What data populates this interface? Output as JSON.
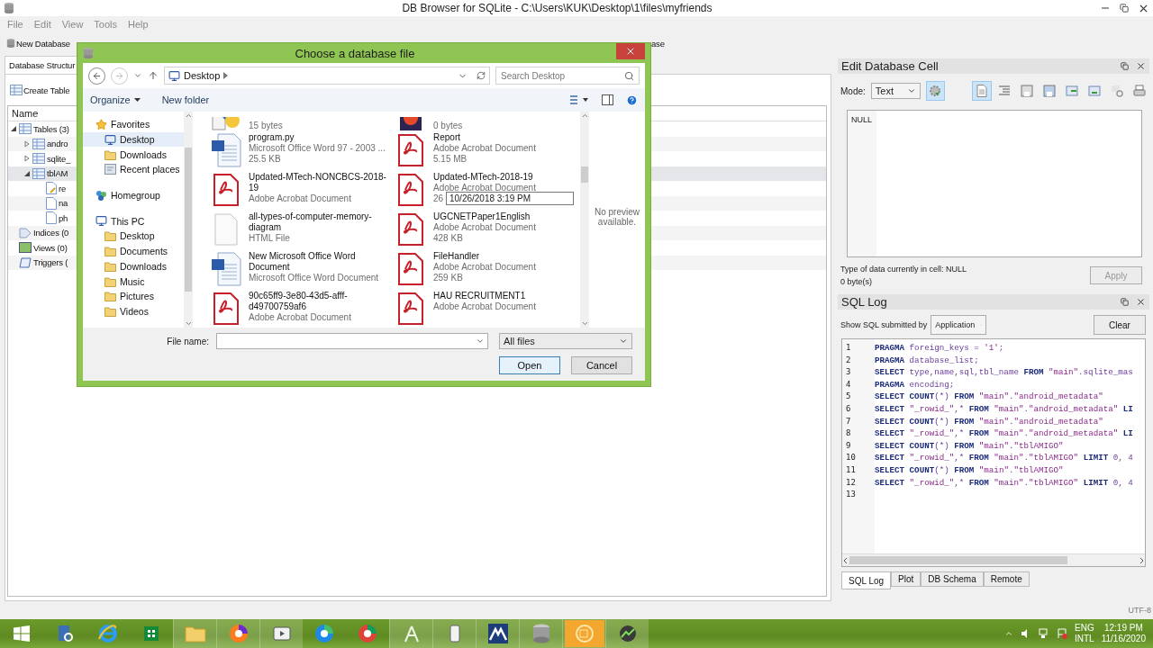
{
  "window": {
    "title": "DB Browser for SQLite - C:\\Users\\KUK\\Desktop\\1\\files\\myfriends"
  },
  "menu": [
    {
      "label": "File",
      "disabled": true
    },
    {
      "label": "Edit",
      "disabled": true
    },
    {
      "label": "View",
      "disabled": true
    },
    {
      "label": "Tools",
      "disabled": true
    },
    {
      "label": "Help",
      "disabled": true
    }
  ],
  "toolbar": [
    {
      "label": "New Database"
    },
    {
      "label": "ase"
    }
  ],
  "main_tabs": [
    {
      "label": "Database Structur",
      "selected": true
    }
  ],
  "structure": {
    "create_button": "Create Table",
    "column": "Name",
    "tree": [
      {
        "label": "Tables (3)",
        "kind": "group",
        "expanded": true,
        "selected": false,
        "children": [
          {
            "label": "andro",
            "kind": "table",
            "expanded": false,
            "selected": false
          },
          {
            "label": "sqlite_",
            "kind": "table",
            "expanded": false,
            "selected": false
          },
          {
            "label": "tblAM",
            "kind": "table",
            "expanded": true,
            "selected": true,
            "children": [
              {
                "label": "re",
                "kind": "key-field",
                "selected": false
              },
              {
                "label": "na",
                "kind": "field",
                "selected": false
              },
              {
                "label": "ph",
                "kind": "field",
                "selected": false
              }
            ]
          }
        ]
      },
      {
        "label": "Indices (0",
        "kind": "index",
        "selected": false
      },
      {
        "label": "Views (0)",
        "kind": "view",
        "selected": false
      },
      {
        "label": "Triggers (",
        "kind": "trigger",
        "selected": false
      }
    ]
  },
  "edit_cell": {
    "title": "Edit Database Cell",
    "mode_label": "Mode:",
    "mode": "Text",
    "auto_switch": {
      "pressed": true
    },
    "tools": [
      {
        "kind": "text",
        "pressed": true
      },
      {
        "kind": "indent",
        "pressed": false
      },
      {
        "kind": "save",
        "pressed": false
      },
      {
        "kind": "save-as",
        "pressed": false
      },
      {
        "kind": "export",
        "pressed": false
      },
      {
        "kind": "import",
        "pressed": false
      },
      {
        "kind": "null",
        "pressed": false
      },
      {
        "kind": "print",
        "pressed": false
      }
    ],
    "value": "NULL",
    "type_info": "Type of data currently in cell: NULL",
    "size_info": "0 byte(s)",
    "apply": {
      "label": "Apply",
      "disabled": true
    }
  },
  "sql_log": {
    "title": "SQL Log",
    "filter_label": "Show SQL submitted by",
    "filter": "Application",
    "clear": "Clear",
    "lines": [
      {
        "number": "1",
        "code": "PRAGMA foreign_keys = '1';"
      },
      {
        "number": "2",
        "code": "PRAGMA database_list;"
      },
      {
        "number": "3",
        "code": "SELECT type,name,sql,tbl_name FROM \"main\".sqlite_mas"
      },
      {
        "number": "4",
        "code": "PRAGMA encoding;"
      },
      {
        "number": "5",
        "code": "SELECT COUNT(*) FROM \"main\".\"android_metadata\""
      },
      {
        "number": "6",
        "code": "SELECT \"_rowid_\",* FROM \"main\".\"android_metadata\" LI"
      },
      {
        "number": "7",
        "code": "SELECT COUNT(*) FROM \"main\".\"android_metadata\""
      },
      {
        "number": "8",
        "code": "SELECT \"_rowid_\",* FROM \"main\".\"android_metadata\" LI"
      },
      {
        "number": "9",
        "code": "SELECT COUNT(*) FROM \"main\".\"tblAMIGO\""
      },
      {
        "number": "10",
        "code": "SELECT \"_rowid_\",* FROM \"main\".\"tblAMIGO\" LIMIT 0, 4"
      },
      {
        "number": "11",
        "code": "SELECT COUNT(*) FROM \"main\".\"tblAMIGO\""
      },
      {
        "number": "12",
        "code": "SELECT \"_rowid_\",* FROM \"main\".\"tblAMIGO\" LIMIT 0, 4"
      },
      {
        "number": "13"
      }
    ]
  },
  "dock_tabs": [
    {
      "label": "SQL Log",
      "selected": true
    },
    {
      "label": "Plot",
      "selected": false
    },
    {
      "label": "DB Schema",
      "selected": false
    },
    {
      "label": "Remote",
      "selected": false
    }
  ],
  "status_bar": {
    "encoding": "UTF-8"
  },
  "dialog": {
    "title": "Choose a database file",
    "address": "Desktop",
    "search": {
      "placeholder": "Search Desktop"
    },
    "commands": [
      {
        "label": "Organize",
        "menu": true
      },
      {
        "label": "New folder",
        "menu": false
      }
    ],
    "nav": [
      {
        "label": "Favorites",
        "kind": "star",
        "selected": false,
        "children": [
          {
            "label": "Desktop",
            "kind": "desktop",
            "selected": true
          },
          {
            "label": "Downloads",
            "kind": "folder",
            "selected": false
          },
          {
            "label": "Recent places",
            "kind": "recent",
            "selected": false
          }
        ]
      },
      {
        "label": "Homegroup",
        "kind": "homegroup",
        "selected": false
      },
      {
        "label": "This PC",
        "kind": "pc",
        "selected": false,
        "children": [
          {
            "label": "Desktop",
            "kind": "folder",
            "selected": false
          },
          {
            "label": "Documents",
            "kind": "folder",
            "selected": false
          },
          {
            "label": "Downloads",
            "kind": "folder",
            "selected": false
          },
          {
            "label": "Music",
            "kind": "folder",
            "selected": false
          },
          {
            "label": "Pictures",
            "kind": "folder",
            "selected": false
          },
          {
            "label": "Videos",
            "kind": "folder",
            "selected": false
          }
        ]
      }
    ],
    "files": [
      {
        "kind": "python",
        "size": "15 bytes"
      },
      {
        "kind": "media",
        "size": "0 bytes"
      },
      {
        "kind": "word",
        "name": "program.py",
        "type": "Microsoft Office Word 97 - 2003 ...",
        "size": "25.5 KB"
      },
      {
        "kind": "pdf",
        "name": "Report",
        "type": "Adobe Acrobat Document",
        "size": "5.15 MB"
      },
      {
        "kind": "pdf",
        "name": "Updated-MTech-NONCBCS-2018-19",
        "type": "Adobe Acrobat Document"
      },
      {
        "kind": "pdf",
        "name": "Updated-MTech-2018-19",
        "type": "Adobe Acrobat Document",
        "size": "26",
        "tooltip": "10/26/2018 3:19 PM"
      },
      {
        "kind": "blank",
        "name": "all-types-of-computer-memory-diagram",
        "type": "HTML File"
      },
      {
        "kind": "pdf",
        "name": "UGCNETPaper1English",
        "type": "Adobe Acrobat Document",
        "size": "428 KB"
      },
      {
        "kind": "word",
        "name": "New Microsoft Office Word Document",
        "type": "Microsoft Office Word Document"
      },
      {
        "kind": "pdf",
        "name": "FileHandler",
        "type": "Adobe Acrobat Document",
        "size": "259 KB"
      },
      {
        "kind": "pdf",
        "name": "90c65ff9-3e80-43d5-afff-d49700759af6",
        "type": "Adobe Acrobat Document"
      },
      {
        "kind": "pdf",
        "name": "HAU RECRUITMENT1",
        "type": "Adobe Acrobat Document"
      }
    ],
    "preview": "No preview available.",
    "file_name_label": "File name:",
    "filter": "All files",
    "buttons": [
      {
        "label": "Open",
        "default": true
      },
      {
        "label": "Cancel",
        "default": false
      }
    ]
  },
  "taskbar": {
    "apps": [
      {
        "kind": "explorer-search",
        "running": false
      },
      {
        "kind": "ie",
        "running": false
      },
      {
        "kind": "store",
        "running": false
      },
      {
        "kind": "folder",
        "running": true
      },
      {
        "kind": "firefox",
        "running": true
      },
      {
        "kind": "video",
        "running": true
      },
      {
        "kind": "edge",
        "running": false
      },
      {
        "kind": "chrome",
        "running": false
      },
      {
        "kind": "android",
        "running": true
      },
      {
        "kind": "phone",
        "running": true
      },
      {
        "kind": "mountain",
        "running": true
      },
      {
        "kind": "database",
        "running": true
      },
      {
        "kind": "camera",
        "running": true
      },
      {
        "kind": "chart",
        "running": true
      }
    ],
    "language": "ENG",
    "layout": "INTL",
    "time": "12:19 PM",
    "date": "11/16/2020"
  }
}
